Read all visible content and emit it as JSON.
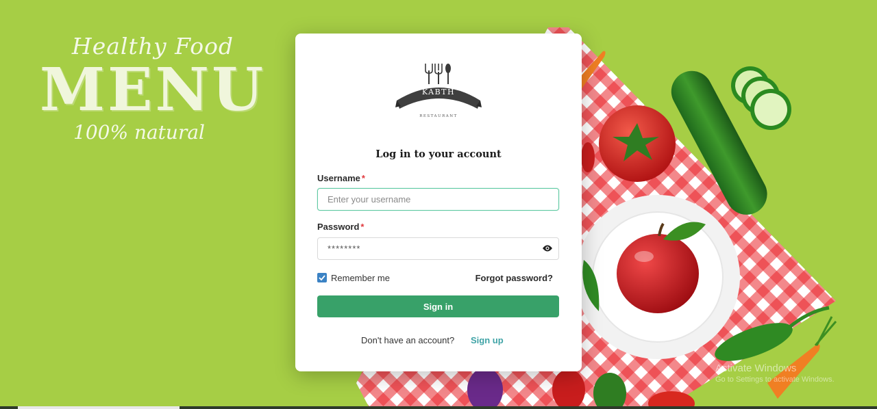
{
  "hero": {
    "script_title": "Healthy Food",
    "big_title": "MENU",
    "subtitle": "100% natural"
  },
  "logo": {
    "name": "KABTH",
    "est": "ETB ★ 2016",
    "tagline": "RESTAURANT"
  },
  "login": {
    "title": "Log in to your account",
    "username_label": "Username",
    "username_placeholder": "Enter your username",
    "password_label": "Password",
    "password_placeholder": "********",
    "required_mark": "*",
    "remember_label": "Remember me",
    "remember_checked": true,
    "forgot_label": "Forgot password?",
    "signin_label": "Sign in",
    "no_account_text": "Don't have an account?",
    "signup_label": "Sign up"
  },
  "watermark": {
    "line1": "Activate Windows",
    "line2": "Go to Settings to activate Windows."
  },
  "colors": {
    "background": "#a6ce45",
    "primary_button": "#38a169",
    "link": "#3fa3a6",
    "required": "#e0393e",
    "focus_border": "#5fc9a2",
    "checkbox": "#3b82c4"
  },
  "icons": {
    "password_toggle": "eye-icon",
    "checkbox": "checkmark-icon"
  }
}
